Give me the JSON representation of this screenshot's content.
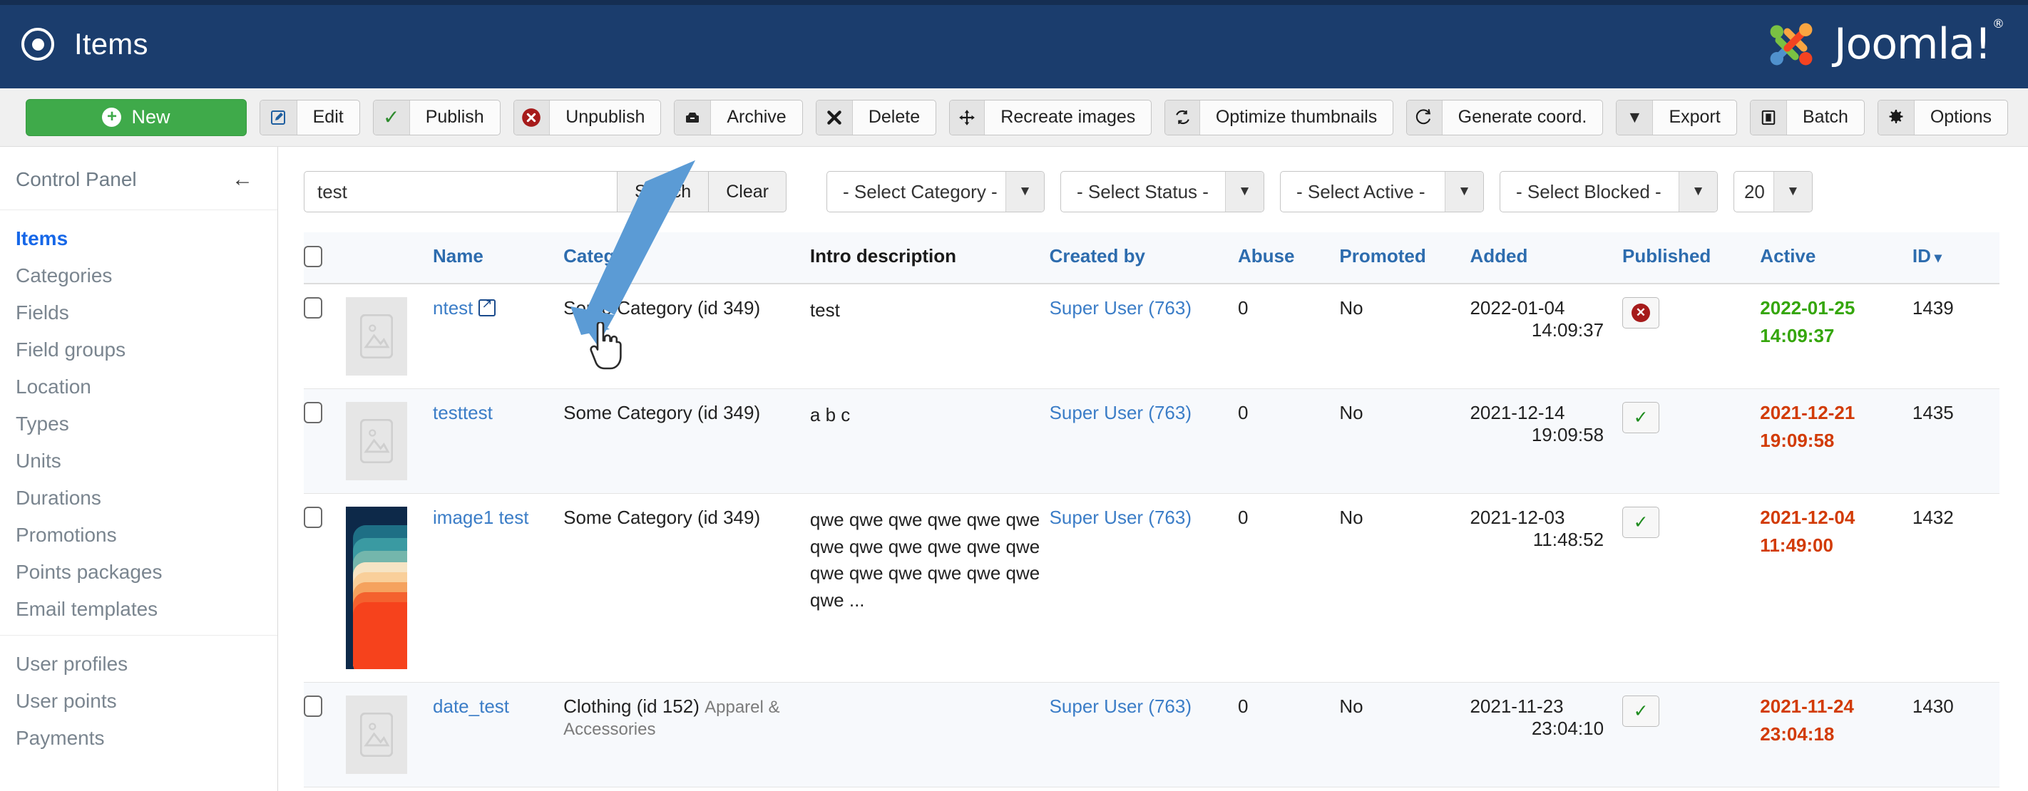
{
  "header": {
    "title": "Items",
    "title_icon": "record-circle-icon",
    "brand": "Joomla!",
    "brand_reg": "®",
    "bg_color": "#1b3d6d"
  },
  "toolbar": {
    "buttons": [
      {
        "label": "New",
        "icon": "plus-circle-icon",
        "primary": true
      },
      {
        "label": "Edit",
        "icon": "pencil-square-icon",
        "primary": false
      },
      {
        "label": "Publish",
        "icon": "check-icon",
        "primary": false
      },
      {
        "label": "Unpublish",
        "icon": "x-circle-icon",
        "primary": false
      },
      {
        "label": "Archive",
        "icon": "archive-box-icon",
        "primary": false
      },
      {
        "label": "Delete",
        "icon": "x-mark-icon",
        "primary": false
      },
      {
        "label": "Recreate images",
        "icon": "move-arrows-icon",
        "primary": false
      },
      {
        "label": "Optimize thumbnails",
        "icon": "refresh-icon",
        "primary": false
      },
      {
        "label": "Generate coord.",
        "icon": "redo-arrow-icon",
        "primary": false
      },
      {
        "label": "Export",
        "icon": "chevron-down-icon",
        "primary": false
      },
      {
        "label": "Batch",
        "icon": "batch-square-icon",
        "primary": false
      },
      {
        "label": "Options",
        "icon": "gear-icon",
        "primary": false
      }
    ]
  },
  "sidebar": {
    "control_panel_label": "Control Panel",
    "collapse_icon": "arrow-left-icon",
    "groups": [
      {
        "items": [
          {
            "label": "Items",
            "active": true
          },
          {
            "label": "Categories",
            "active": false
          },
          {
            "label": "Fields",
            "active": false
          },
          {
            "label": "Field groups",
            "active": false
          },
          {
            "label": "Location",
            "active": false
          },
          {
            "label": "Types",
            "active": false
          },
          {
            "label": "Units",
            "active": false
          },
          {
            "label": "Durations",
            "active": false
          },
          {
            "label": "Promotions",
            "active": false
          },
          {
            "label": "Points packages",
            "active": false
          },
          {
            "label": "Email templates",
            "active": false
          }
        ]
      },
      {
        "items": [
          {
            "label": "User profiles",
            "active": false
          },
          {
            "label": "User points",
            "active": false
          },
          {
            "label": "Payments",
            "active": false
          }
        ]
      }
    ]
  },
  "filters": {
    "search_value": "test",
    "search_placeholder": "",
    "search_button": "Search",
    "clear_button": "Clear",
    "selects": [
      {
        "name": "category",
        "value": "- Select Category -"
      },
      {
        "name": "status",
        "value": "- Select Status -"
      },
      {
        "name": "active",
        "value": "- Select Active -"
      },
      {
        "name": "blocked",
        "value": "- Select Blocked -"
      }
    ],
    "page_limit": "20"
  },
  "table": {
    "columns": [
      {
        "key": "check",
        "label": "",
        "sortable": false,
        "link": false
      },
      {
        "key": "thumb",
        "label": "",
        "sortable": false,
        "link": false
      },
      {
        "key": "name",
        "label": "Name",
        "sortable": true,
        "link": true
      },
      {
        "key": "cat",
        "label": "Category",
        "sortable": true,
        "link": true
      },
      {
        "key": "intro",
        "label": "Intro description",
        "sortable": false,
        "link": false
      },
      {
        "key": "by",
        "label": "Created by",
        "sortable": true,
        "link": true
      },
      {
        "key": "abuse",
        "label": "Abuse",
        "sortable": true,
        "link": true
      },
      {
        "key": "prom",
        "label": "Promoted",
        "sortable": true,
        "link": true
      },
      {
        "key": "added",
        "label": "Added",
        "sortable": true,
        "link": true
      },
      {
        "key": "pub",
        "label": "Published",
        "sortable": true,
        "link": true
      },
      {
        "key": "act",
        "label": "Active",
        "sortable": true,
        "link": true
      },
      {
        "key": "id",
        "label": "ID",
        "sortable": true,
        "link": true,
        "sort_indicator": "▾"
      }
    ],
    "rows": [
      {
        "name": "ntest",
        "name_has_external_icon": true,
        "category": "Some Category (id 349)",
        "category_sub": "",
        "intro": "test",
        "created_by": "Super User (763)",
        "abuse": "0",
        "promoted": "No",
        "added_date": "2022-01-04",
        "added_time": "14:09:37",
        "published": "unpublished",
        "active_date": "2022-01-25",
        "active_time": "14:09:37",
        "active_color": "green",
        "id": "1439",
        "thumb": "placeholder"
      },
      {
        "name": "testtest",
        "name_has_external_icon": false,
        "category": "Some Category (id 349)",
        "category_sub": "",
        "intro": "a b c",
        "created_by": "Super User (763)",
        "abuse": "0",
        "promoted": "No",
        "added_date": "2021-12-14",
        "added_time": "19:09:58",
        "published": "published",
        "active_date": "2021-12-21",
        "active_time": "19:09:58",
        "active_color": "red",
        "id": "1435",
        "thumb": "placeholder"
      },
      {
        "name": "image1 test",
        "name_has_external_icon": false,
        "category": "Some Category (id 349)",
        "category_sub": "",
        "intro": "qwe qwe qwe qwe qwe qwe qwe qwe qwe qwe qwe qwe qwe qwe qwe qwe qwe qwe qwe ...",
        "created_by": "Super User (763)",
        "abuse": "0",
        "promoted": "No",
        "added_date": "2021-12-03",
        "added_time": "11:48:52",
        "published": "published",
        "active_date": "2021-12-04",
        "active_time": "11:49:00",
        "active_color": "red",
        "id": "1432",
        "thumb": "image"
      },
      {
        "name": "date_test",
        "name_has_external_icon": false,
        "category": "Clothing (id 152)",
        "category_sub": "Apparel & Accessories",
        "intro": "",
        "created_by": "Super User (763)",
        "abuse": "0",
        "promoted": "No",
        "added_date": "2021-11-23",
        "added_time": "23:04:10",
        "published": "published",
        "active_date": "2021-11-24",
        "active_time": "23:04:18",
        "active_color": "red",
        "id": "1430",
        "thumb": "placeholder"
      }
    ]
  },
  "colors": {
    "header_blue": "#1b3d6d",
    "link_blue": "#3b7dc7",
    "header_link_blue": "#2d6cae",
    "new_green": "#3faa4a",
    "active_green": "#35a60b",
    "active_red": "#d23b06",
    "unpublish_red": "#a61b1b",
    "annotation_blue": "#5b9bd5"
  }
}
